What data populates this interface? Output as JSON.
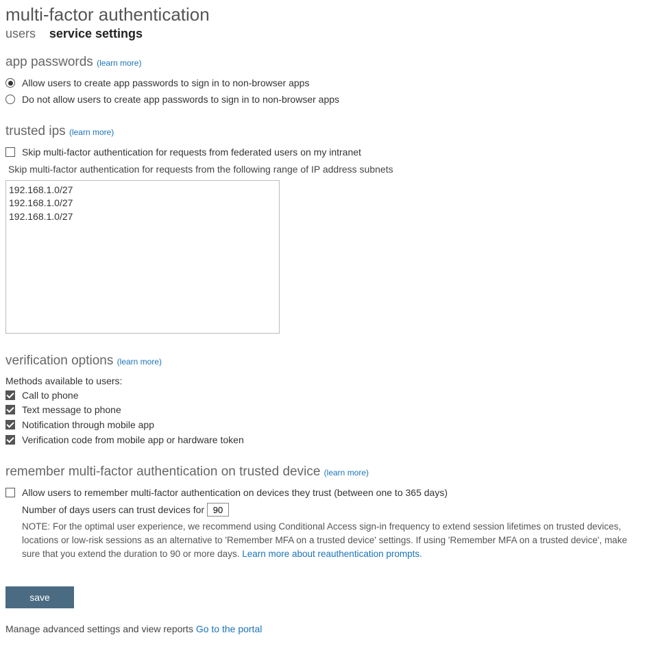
{
  "page": {
    "title": "multi-factor authentication"
  },
  "tabs": {
    "users": "users",
    "service_settings": "service settings"
  },
  "app_passwords": {
    "heading": "app passwords",
    "learn_more": "learn more",
    "option_allow": "Allow users to create app passwords to sign in to non-browser apps",
    "option_disallow": "Do not allow users to create app passwords to sign in to non-browser apps"
  },
  "trusted_ips": {
    "heading": "trusted ips",
    "learn_more": "learn more",
    "skip_federated": "Skip multi-factor authentication for requests from federated users on my intranet",
    "subnet_label": "Skip multi-factor authentication for requests from the following range of IP address subnets",
    "textarea_value": "192.168.1.0/27\n192.168.1.0/27\n192.168.1.0/27"
  },
  "verification": {
    "heading": "verification options",
    "learn_more": "learn more",
    "methods_label": "Methods available to users:",
    "opt_call": "Call to phone",
    "opt_sms": "Text message to phone",
    "opt_app_notify": "Notification through mobile app",
    "opt_app_code": "Verification code from mobile app or hardware token"
  },
  "remember": {
    "heading": "remember multi-factor authentication on trusted device",
    "learn_more": "learn more",
    "allow_label": "Allow users to remember multi-factor authentication on devices they trust (between one to 365 days)",
    "days_label": "Number of days users can trust devices for",
    "days_value": "90",
    "note_prefix": "NOTE: For the optimal user experience, we recommend using Conditional Access sign-in frequency to extend session lifetimes on trusted devices, locations or low-risk sessions as an alternative to 'Remember MFA on a trusted device' settings. If using 'Remember MFA on a trusted device', make sure that you extend the duration to 90 or more days. ",
    "note_link": "Learn more about reauthentication prompts."
  },
  "actions": {
    "save": "save"
  },
  "footer": {
    "text": "Manage advanced settings and view reports ",
    "link": "Go to the portal"
  }
}
